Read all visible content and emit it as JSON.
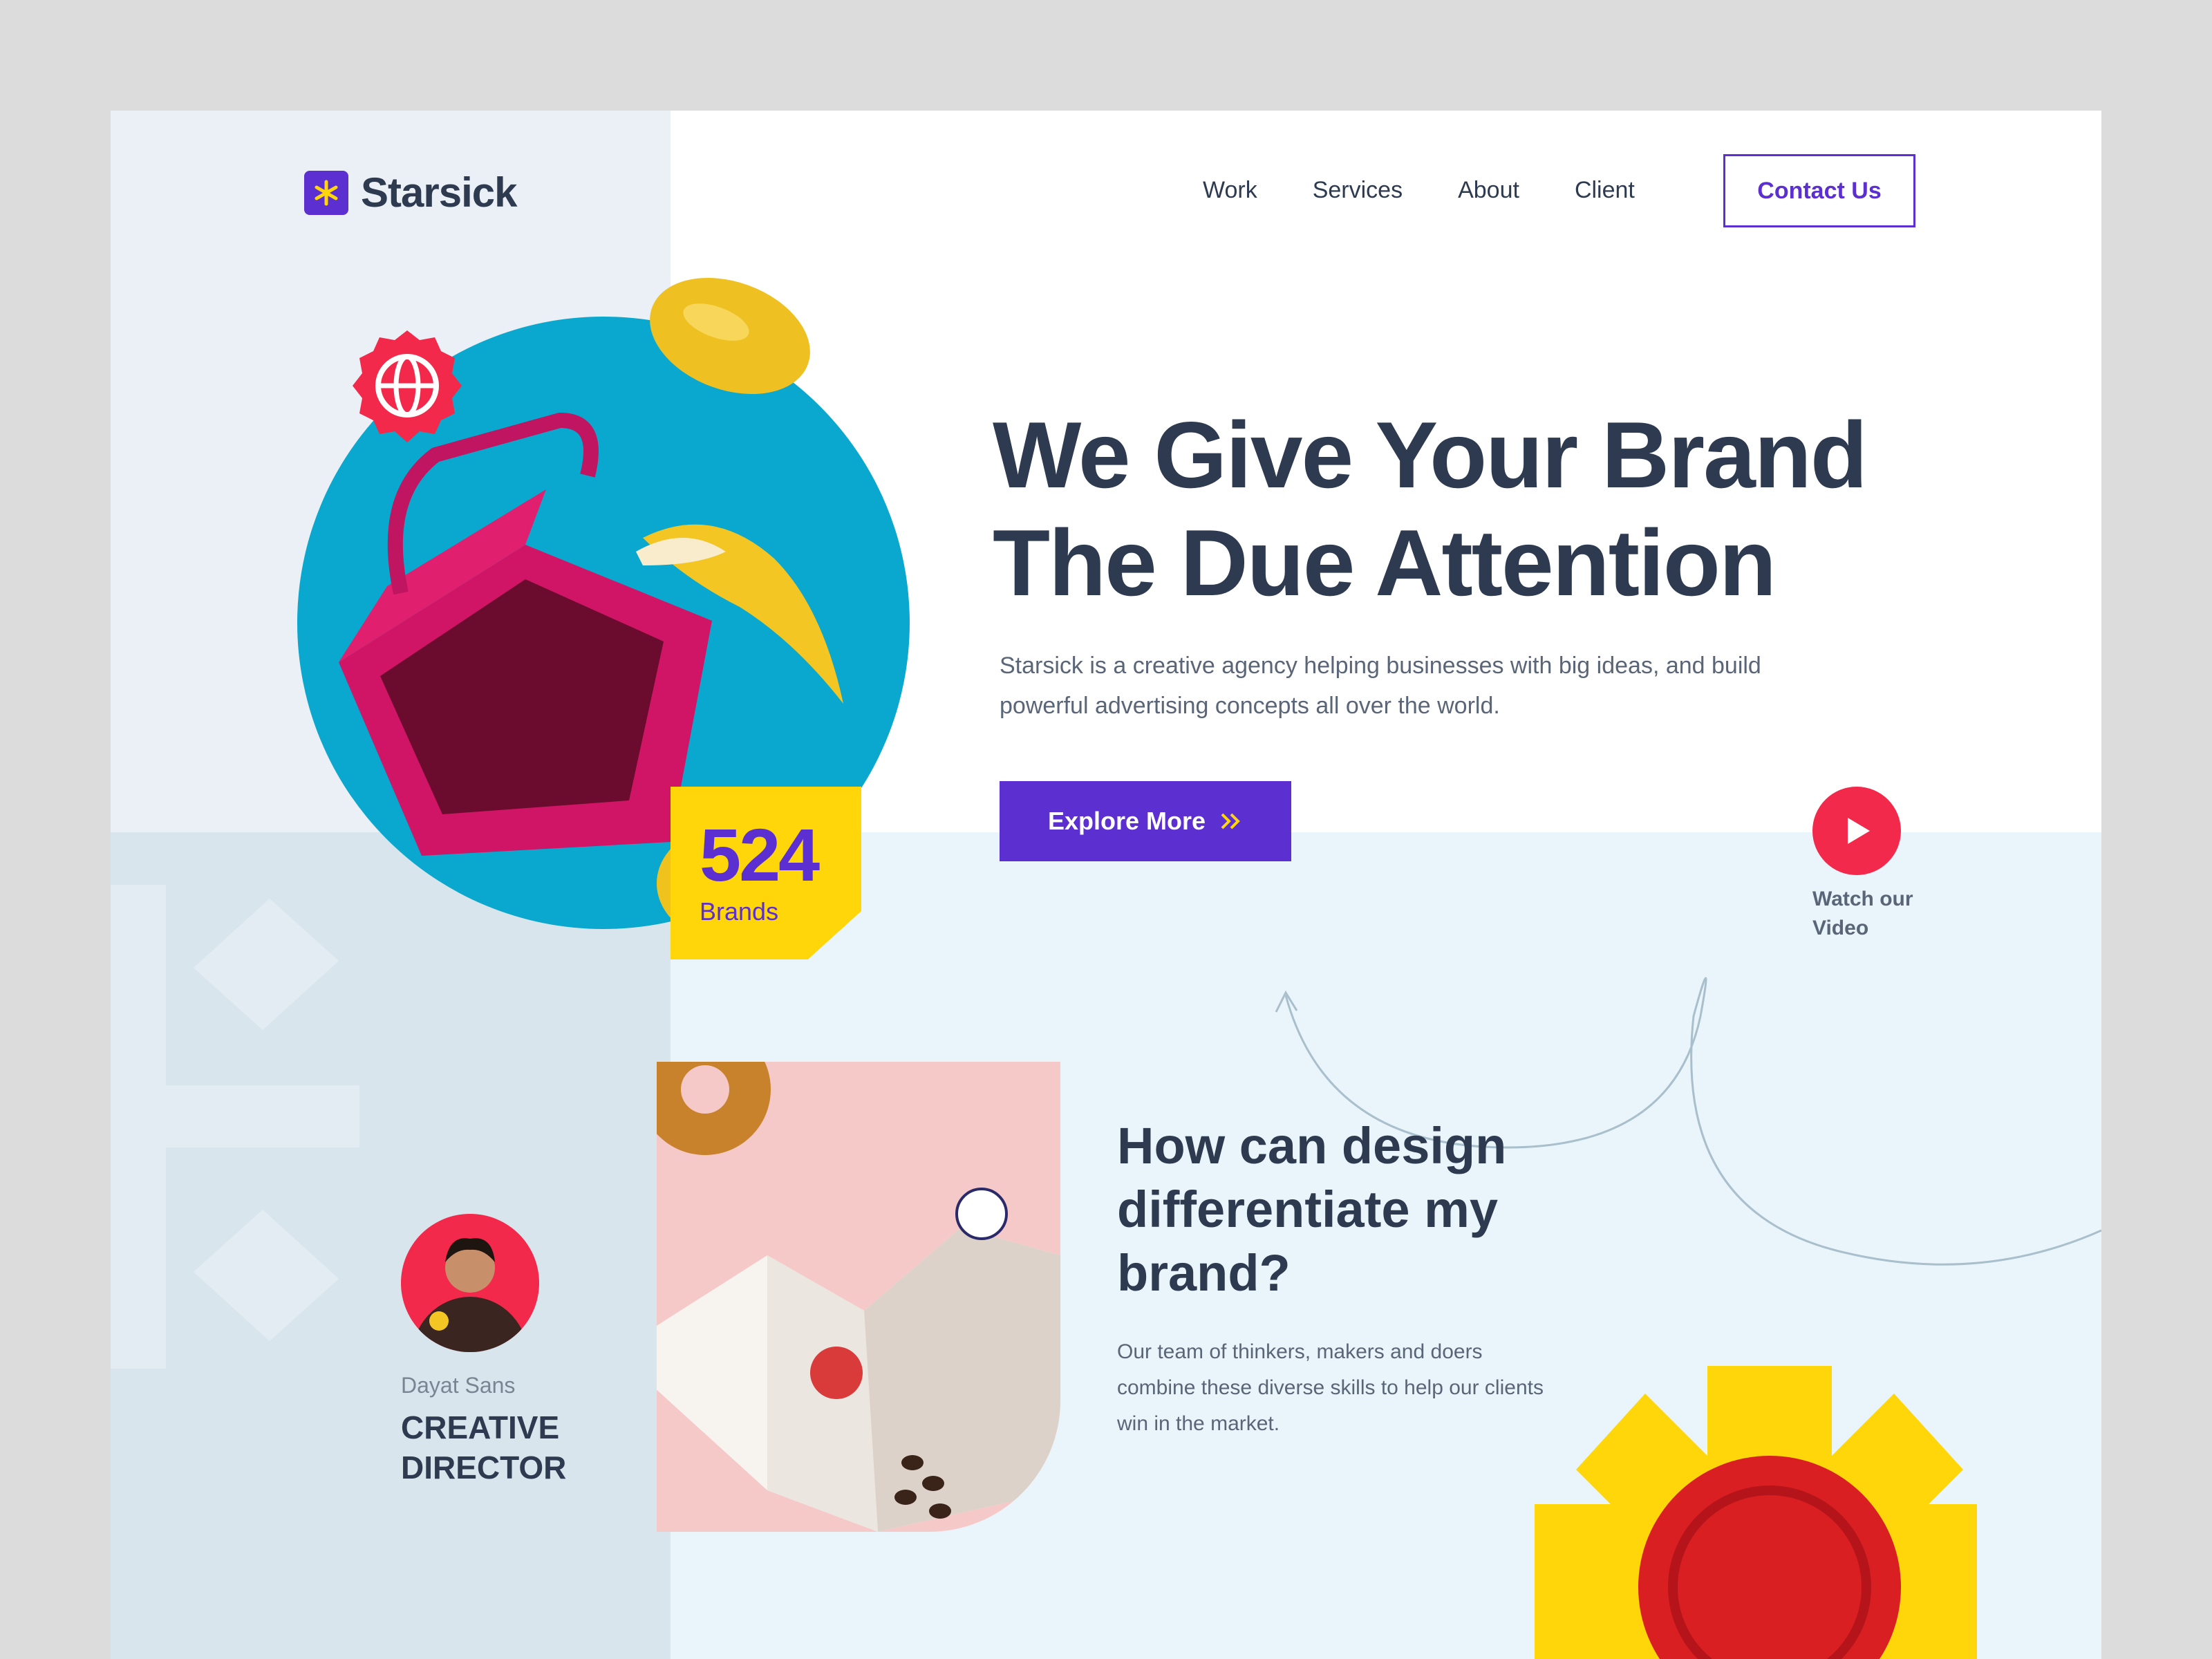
{
  "brand": {
    "name": "Starsick",
    "accent": "#5b2fd0",
    "logo_icon": "asterisk-icon"
  },
  "nav": {
    "items": [
      "Work",
      "Services",
      "About",
      "Client"
    ],
    "contact_label": "Contact Us"
  },
  "hero": {
    "title_line1": "We Give Your Brand",
    "title_line2": "The Due Attention",
    "description": "Starsick is a creative agency helping businesses with big ideas, and build powerful advertising concepts all over the world.",
    "explore_label": "Explore More",
    "watch_label": "Watch our Video",
    "stat": {
      "number": "524",
      "label": "Brands"
    }
  },
  "feature": {
    "title": "How can design differentiate my brand?",
    "description": "Our team of thinkers, makers and doers combine these diverse skills to help our clients win in the market."
  },
  "person": {
    "name": "Dayat Sans",
    "role": "CREATIVE DIRECTOR"
  },
  "colors": {
    "yellow": "#ffd60a",
    "red": "#f2294a",
    "blue": "#0aa8cf",
    "dark": "#2d3a4f"
  }
}
